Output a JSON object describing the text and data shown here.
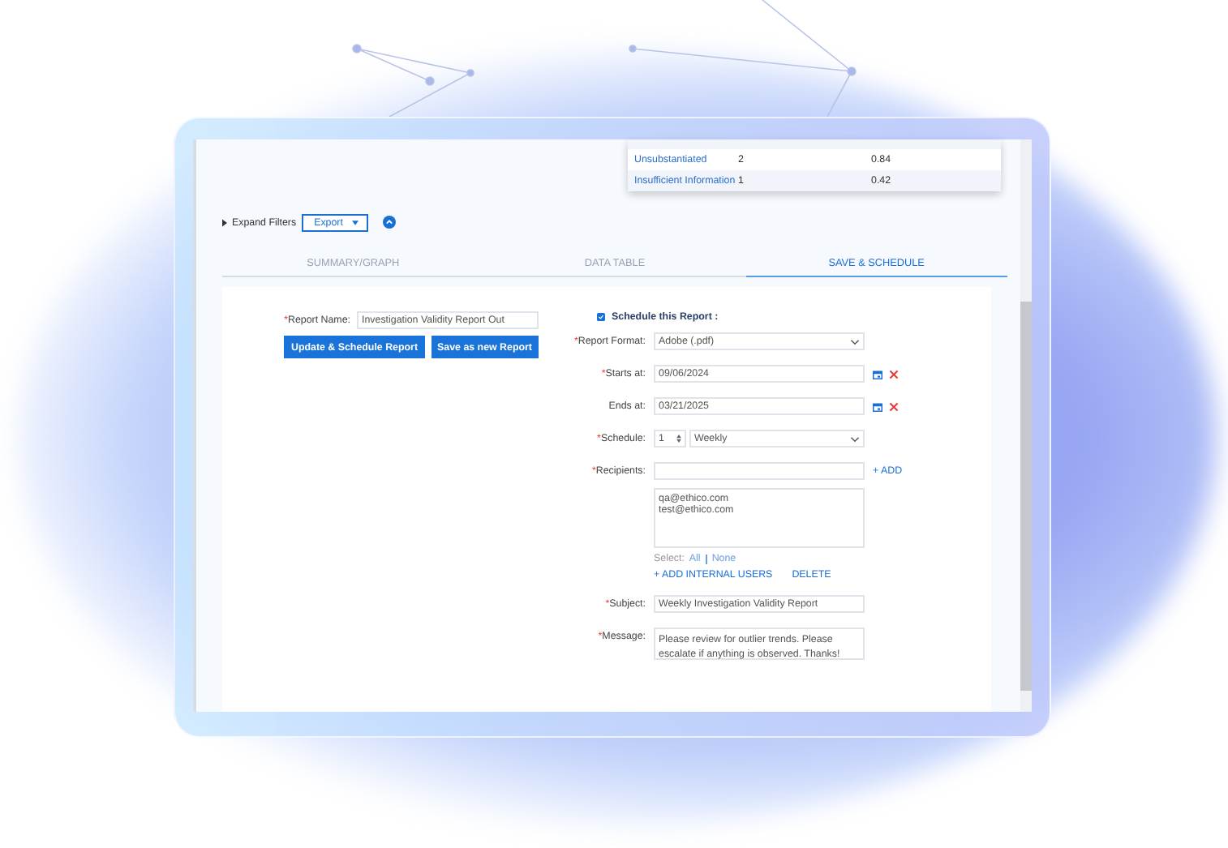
{
  "summary_table": {
    "rows": [
      {
        "label": "Unsubstantiated",
        "count": "2",
        "percent": "0.84"
      },
      {
        "label": "Insufficient Information",
        "count": "1",
        "percent": "0.42"
      }
    ]
  },
  "required_mark": "*",
  "filters": {
    "toggle": "Expand Filters",
    "export": "Export"
  },
  "tabs": [
    {
      "label": "SUMMARY/GRAPH",
      "selected": false
    },
    {
      "label": "DATA TABLE",
      "selected": false
    },
    {
      "label": "SAVE & SCHEDULE",
      "selected": true
    }
  ],
  "report_name": {
    "label": "Report Name:",
    "required": true,
    "value": "Investigation Validity Report Out"
  },
  "buttons": [
    "Update & Schedule Report",
    "Save as new Report"
  ],
  "schedule_checkbox": {
    "label": "Schedule this Report :",
    "checked": true
  },
  "fields": [
    {
      "kind": "select",
      "label": "Report Format:",
      "required": true,
      "value": "Adobe (.pdf)"
    },
    {
      "kind": "date",
      "label": "Starts at:",
      "required": true,
      "value": "09/06/2024"
    },
    {
      "kind": "date",
      "label": "Ends at:",
      "required": false,
      "value": "03/21/2025"
    },
    {
      "kind": "schedule",
      "label": "Schedule:",
      "required": true,
      "count": "1",
      "value": "Weekly"
    },
    {
      "kind": "recipients",
      "label": "Recipients:",
      "required": true,
      "action": "+ ADD"
    }
  ],
  "recipient_list": {
    "emails": [
      "qa@ethico.com",
      "test@ethico.com"
    ],
    "select_label": "Select:",
    "select_all": "All",
    "select_none": "None",
    "add_users": "+ ADD INTERNAL USERS",
    "delete": "DELETE"
  },
  "subject": {
    "label": "Subject:",
    "required": true,
    "value": "Weekly Investigation Validity Report"
  },
  "message": {
    "label": "Message:",
    "required": true,
    "value": "Please review for outlier trends. Please escalate if anything is observed. Thanks!"
  }
}
